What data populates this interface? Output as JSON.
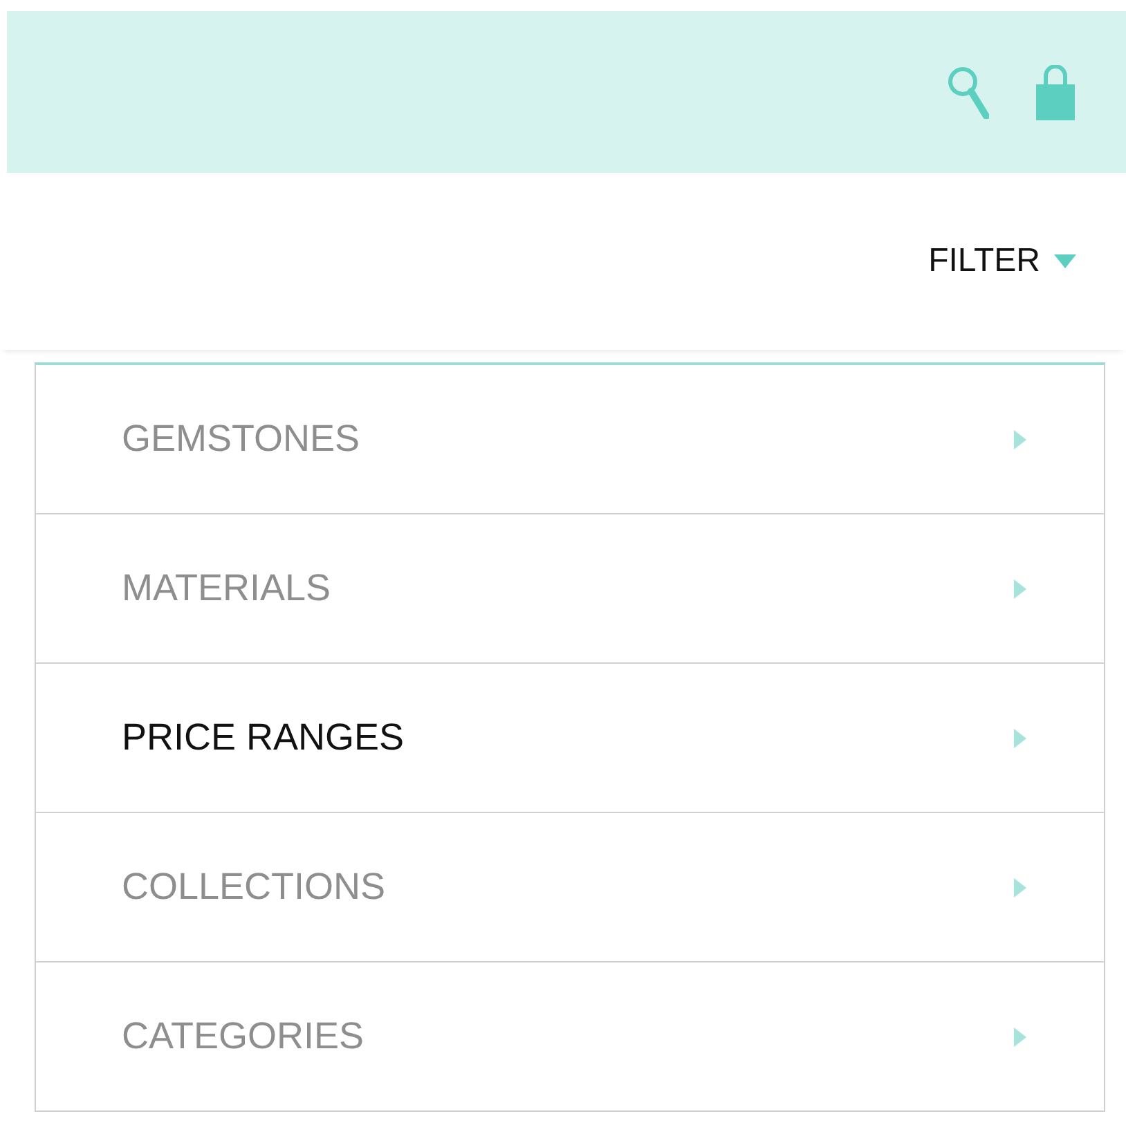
{
  "filter": {
    "label": "FILTER",
    "expanded": true
  },
  "menu": [
    {
      "label": "GEMSTONES",
      "selected": false
    },
    {
      "label": "MATERIALS",
      "selected": false
    },
    {
      "label": "PRICE RANGES",
      "selected": true
    },
    {
      "label": "COLLECTIONS",
      "selected": false
    },
    {
      "label": "CATEGORIES",
      "selected": false
    }
  ]
}
